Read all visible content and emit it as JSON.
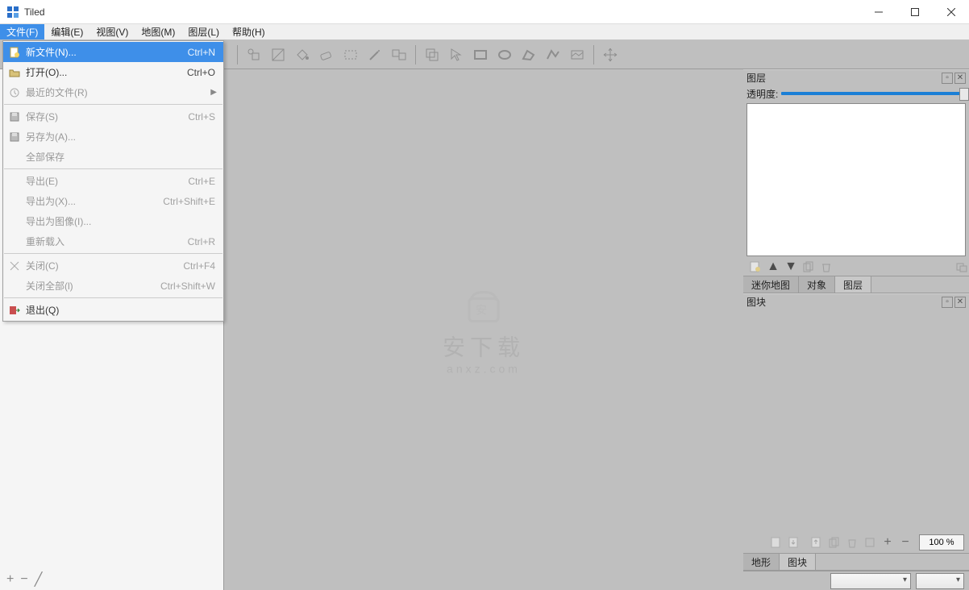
{
  "window": {
    "title": "Tiled"
  },
  "menubar": [
    "文件(F)",
    "编辑(E)",
    "视图(V)",
    "地图(M)",
    "图层(L)",
    "帮助(H)"
  ],
  "file_menu": {
    "items": [
      {
        "icon": "new",
        "label": "新文件(N)...",
        "shortcut": "Ctrl+N",
        "highlighted": true
      },
      {
        "icon": "open",
        "label": "打开(O)...",
        "shortcut": "Ctrl+O"
      },
      {
        "icon": "recent",
        "label": "最近的文件(R)",
        "submenu": true,
        "disabled": true
      },
      {
        "sep": true
      },
      {
        "icon": "save",
        "label": "保存(S)",
        "shortcut": "Ctrl+S",
        "disabled": true
      },
      {
        "icon": "saveas",
        "label": "另存为(A)...",
        "disabled": true
      },
      {
        "label": "全部保存",
        "disabled": true
      },
      {
        "sep": true
      },
      {
        "label": "导出(E)",
        "shortcut": "Ctrl+E",
        "disabled": true
      },
      {
        "label": "导出为(X)...",
        "shortcut": "Ctrl+Shift+E",
        "disabled": true
      },
      {
        "label": "导出为图像(I)...",
        "disabled": true
      },
      {
        "label": "重新载入",
        "shortcut": "Ctrl+R",
        "disabled": true
      },
      {
        "sep": true
      },
      {
        "icon": "close",
        "label": "关闭(C)",
        "shortcut": "Ctrl+F4",
        "disabled": true
      },
      {
        "label": "关闭全部(l)",
        "shortcut": "Ctrl+Shift+W",
        "disabled": true
      },
      {
        "sep": true
      },
      {
        "icon": "exit",
        "label": "退出(Q)"
      }
    ]
  },
  "toolbar_icons": [
    "person",
    "stamp",
    "fill",
    "eraser",
    "marquee",
    "wand",
    "picker",
    "sep",
    "pointer",
    "arrow",
    "square",
    "circle",
    "poly",
    "polyline",
    "image",
    "sep",
    "move"
  ],
  "watermark": {
    "line1": "安下载",
    "line2": "anxz.com"
  },
  "right_panel": {
    "layers_title": "图层",
    "opacity_label": "透明度:",
    "tabs_top": [
      "迷你地图",
      "对象",
      "图层"
    ],
    "tileset_title": "图块",
    "tabs_bottom": [
      "地形",
      "图块"
    ],
    "zoom_label": "100 %"
  }
}
